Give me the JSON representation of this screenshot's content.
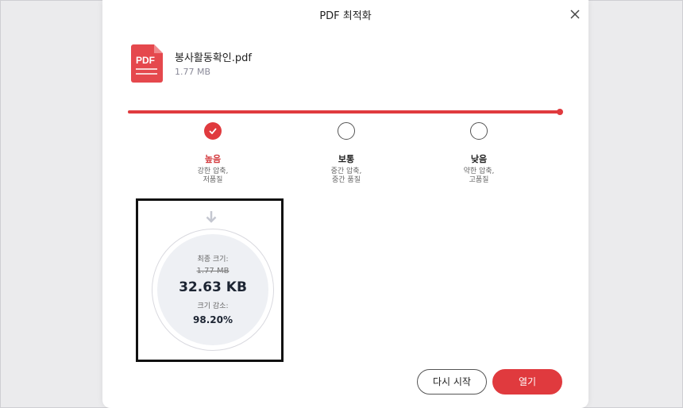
{
  "dialog": {
    "title": "PDF 최적화"
  },
  "file": {
    "icon_label": "PDF",
    "name": "봉사활동확인.pdf",
    "size": "1.77 MB"
  },
  "compression": {
    "level_fraction": 1.0,
    "options": [
      {
        "title": "높음",
        "desc_line1": "강한 압축,",
        "desc_line2": "저품질",
        "selected": true
      },
      {
        "title": "보통",
        "desc_line1": "중간 압축,",
        "desc_line2": "중간 품질",
        "selected": false
      },
      {
        "title": "낮음",
        "desc_line1": "약한 압축,",
        "desc_line2": "고품질",
        "selected": false
      }
    ]
  },
  "result": {
    "final_label": "최종 크기:",
    "original_size": "1.77 MB",
    "final_size": "32.63 KB",
    "reduce_label": "크기 감소:",
    "reduce_value": "98.20%"
  },
  "buttons": {
    "restart": "다시 시작",
    "open": "열기"
  },
  "colors": {
    "accent": "#e03a3e",
    "text_dark": "#1d2533"
  },
  "icons": {
    "close": "close-icon",
    "file": "pdf-file-icon",
    "check": "check-icon",
    "arrow": "arrow-down-icon"
  }
}
